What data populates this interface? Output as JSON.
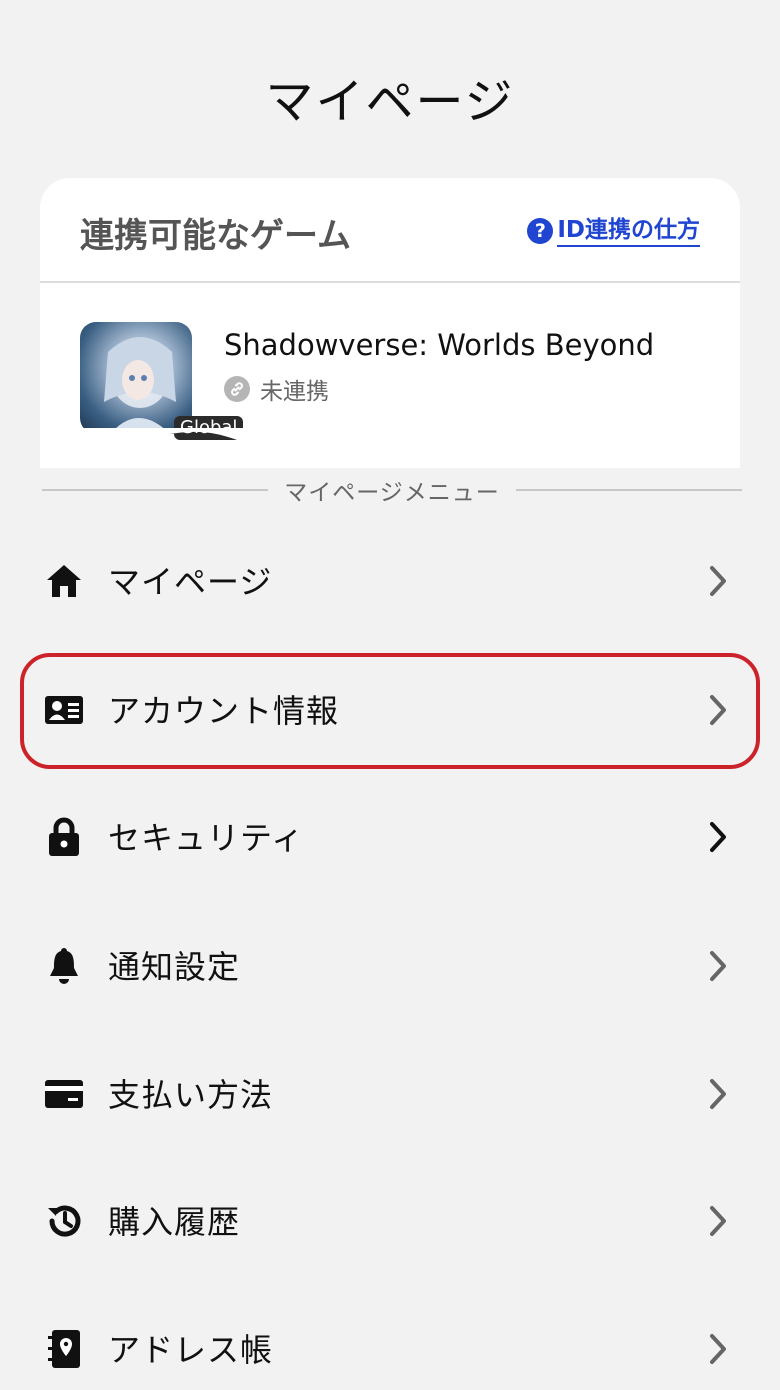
{
  "page_title": "マイページ",
  "linkable_games": {
    "title": "連携可能なゲーム",
    "howto_label": "ID連携の仕方",
    "game": {
      "name": "Shadowverse: Worlds Beyond",
      "badge": "Global",
      "status": "未連携"
    }
  },
  "menu_section_label": "マイページメニュー",
  "menu": [
    {
      "label": "マイページ",
      "icon": "home-icon"
    },
    {
      "label": "アカウント情報",
      "icon": "id-card-icon"
    },
    {
      "label": "セキュリティ",
      "icon": "lock-icon"
    },
    {
      "label": "通知設定",
      "icon": "bell-icon"
    },
    {
      "label": "支払い方法",
      "icon": "credit-card-icon"
    },
    {
      "label": "購入履歴",
      "icon": "history-icon"
    },
    {
      "label": "アドレス帳",
      "icon": "address-book-icon"
    }
  ],
  "colors": {
    "accent_link": "#1f45d1",
    "highlight": "#cc2229",
    "background": "#f2f2f2"
  }
}
